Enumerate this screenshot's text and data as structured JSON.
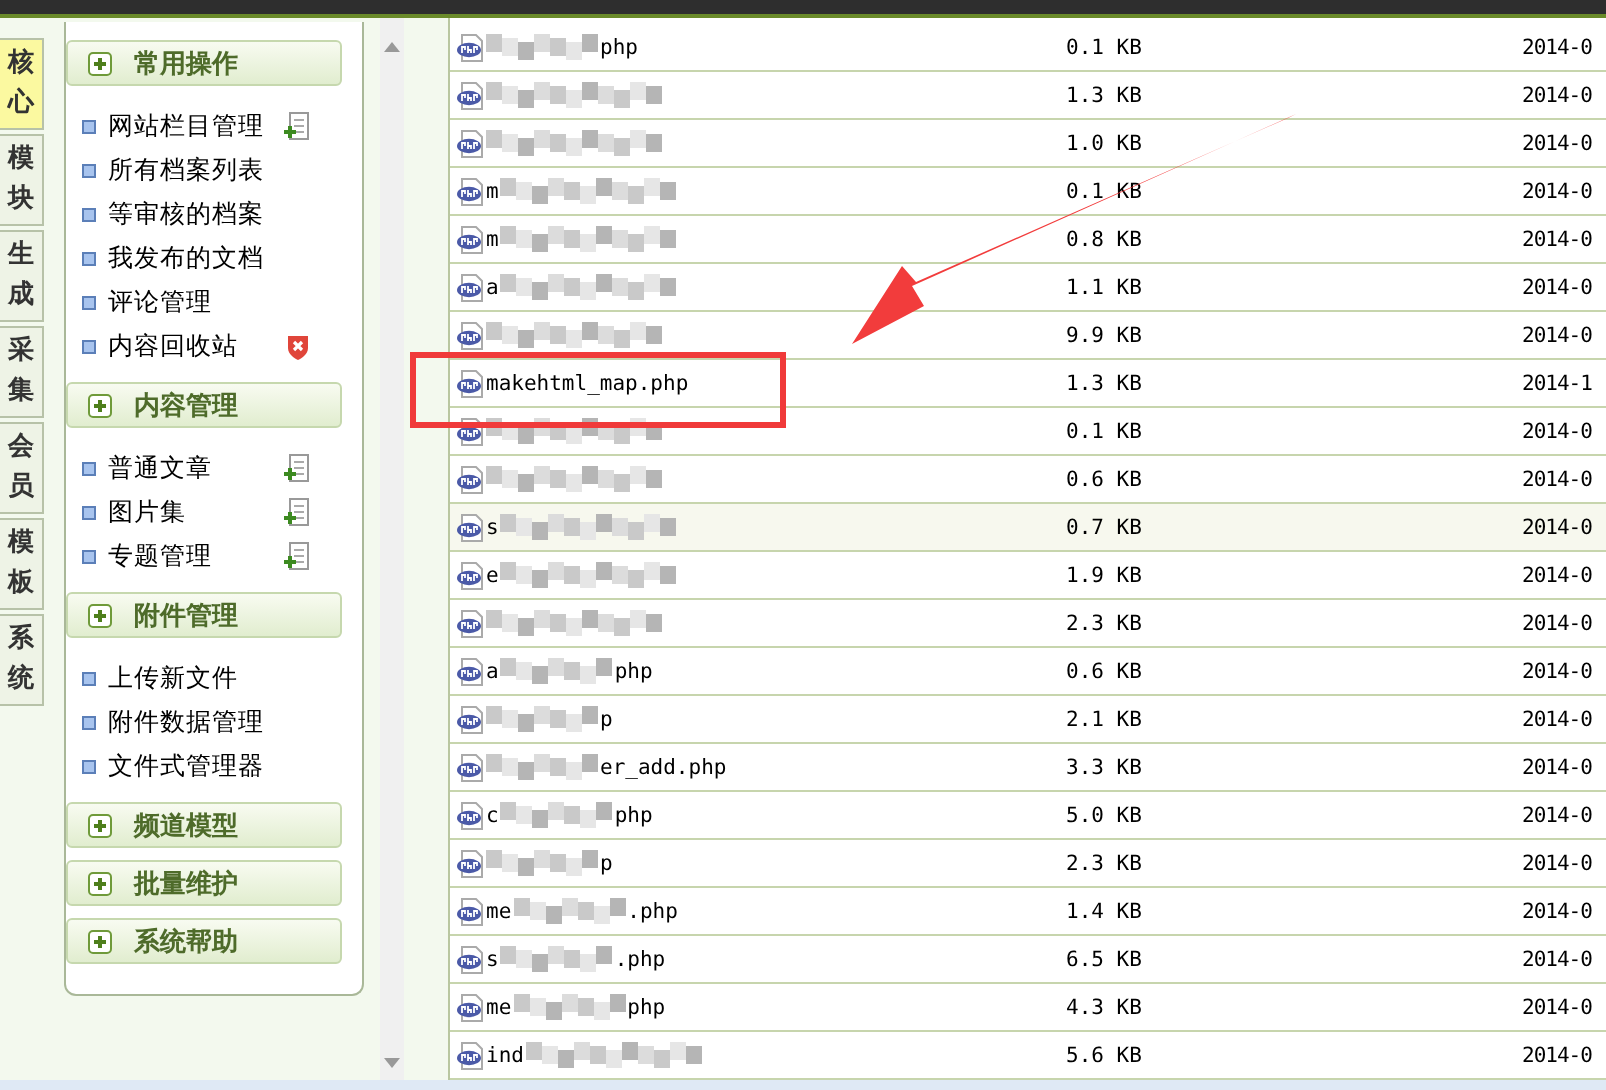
{
  "tabs": [
    {
      "label": "核心",
      "selected": true
    },
    {
      "label": "模块",
      "selected": false
    },
    {
      "label": "生成",
      "selected": false
    },
    {
      "label": "采集",
      "selected": false
    },
    {
      "label": "会员",
      "selected": false
    },
    {
      "label": "模板",
      "selected": false
    },
    {
      "label": "系统",
      "selected": false
    }
  ],
  "menu_groups": [
    {
      "title": "常用操作",
      "items": [
        {
          "label": "网站栏目管理",
          "kind": "add"
        },
        {
          "label": "所有档案列表",
          "kind": "plain"
        },
        {
          "label": "等审核的档案",
          "kind": "plain"
        },
        {
          "label": "我发布的文档",
          "kind": "plain"
        },
        {
          "label": "评论管理",
          "kind": "plain"
        },
        {
          "label": "内容回收站",
          "kind": "delete"
        }
      ]
    },
    {
      "title": "内容管理",
      "items": [
        {
          "label": "普通文章",
          "kind": "add"
        },
        {
          "label": "图片集",
          "kind": "add"
        },
        {
          "label": "专题管理",
          "kind": "add"
        }
      ]
    },
    {
      "title": "附件管理",
      "items": [
        {
          "label": "上传新文件",
          "kind": "plain"
        },
        {
          "label": "附件数据管理",
          "kind": "plain"
        },
        {
          "label": "文件式管理器",
          "kind": "plain"
        }
      ]
    },
    {
      "title": "频道模型"
    },
    {
      "title": "批量维护"
    },
    {
      "title": "系统帮助"
    }
  ],
  "files": [
    {
      "name_end": "php",
      "blurred": true,
      "size": "0.1 KB",
      "date": "2014-0",
      "selected": false
    },
    {
      "blurred": true,
      "size": "1.3 KB",
      "date": "2014-0",
      "selected": false
    },
    {
      "blurred": true,
      "size": "1.0 KB",
      "date": "2014-0",
      "selected": false
    },
    {
      "name_start": "m",
      "blurred": true,
      "size": "0.1 KB",
      "date": "2014-0",
      "selected": false
    },
    {
      "name_start": "m",
      "blurred": true,
      "size": "0.8 KB",
      "date": "2014-0",
      "selected": false
    },
    {
      "name_start": "a",
      "blurred": true,
      "size": "1.1 KB",
      "date": "2014-0",
      "selected": false
    },
    {
      "blurred": true,
      "size": "9.9 KB",
      "date": "2014-0",
      "selected": false
    },
    {
      "name_start": "makehtml_map.php",
      "blurred": false,
      "size": "1.3 KB",
      "date": "2014-1",
      "selected": false
    },
    {
      "blurred": true,
      "size": "0.1 KB",
      "date": "2014-0",
      "selected": false
    },
    {
      "blurred": true,
      "size": "0.6 KB",
      "date": "2014-0",
      "selected": false
    },
    {
      "name_start": "s",
      "blurred": true,
      "size": "0.7 KB",
      "date": "2014-0",
      "selected": true
    },
    {
      "name_start": "e",
      "blurred": true,
      "size": "1.9 KB",
      "date": "2014-0",
      "selected": false
    },
    {
      "blurred": true,
      "size": "2.3 KB",
      "date": "2014-0",
      "selected": false
    },
    {
      "name_start": "a",
      "name_end": "php",
      "blurred": true,
      "size": "0.6 KB",
      "date": "2014-0",
      "selected": false
    },
    {
      "name_end": "p",
      "blurred": true,
      "size": "2.1 KB",
      "date": "2014-0",
      "selected": false
    },
    {
      "name_end": "er_add.php",
      "blurred": true,
      "size": "3.3 KB",
      "date": "2014-0",
      "selected": false
    },
    {
      "name_start": "c",
      "name_end": "php",
      "blurred": true,
      "size": "5.0 KB",
      "date": "2014-0",
      "selected": false
    },
    {
      "name_end": "p",
      "blurred": true,
      "size": "2.3 KB",
      "date": "2014-0",
      "selected": false
    },
    {
      "name_start": "me",
      "name_end": ".php",
      "blurred": true,
      "size": "1.4 KB",
      "date": "2014-0",
      "selected": false
    },
    {
      "name_start": "s",
      "name_end": ".php",
      "blurred": true,
      "size": "6.5 KB",
      "date": "2014-0",
      "selected": false
    },
    {
      "name_start": "me",
      "name_end": "php",
      "blurred": true,
      "size": "4.3 KB",
      "date": "2014-0",
      "selected": false
    },
    {
      "name_start": "ind",
      "blurred": true,
      "size": "5.6 KB",
      "date": "2014-0",
      "selected": false
    }
  ]
}
